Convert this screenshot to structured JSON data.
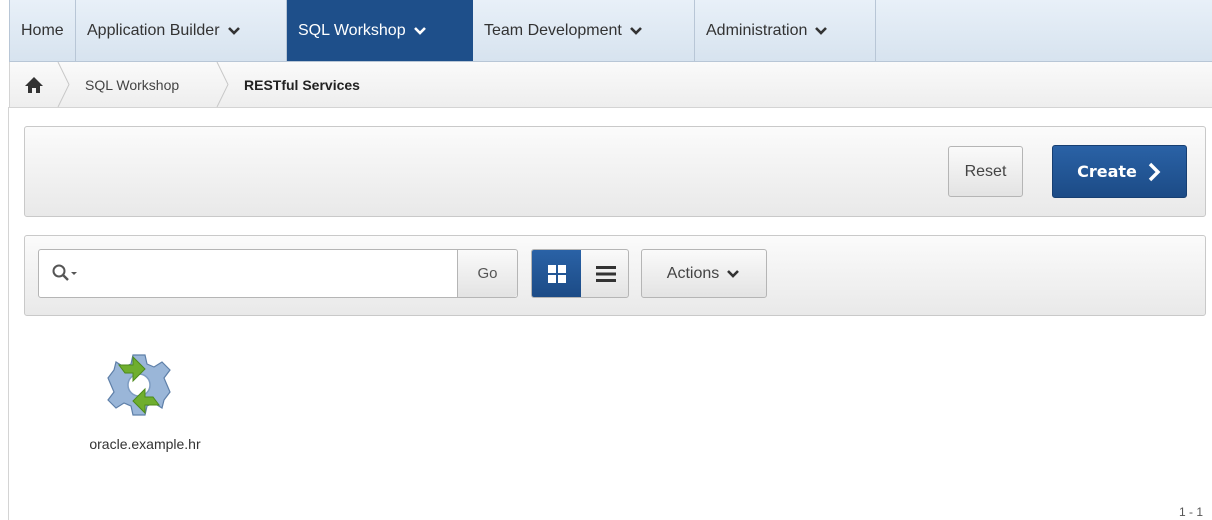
{
  "nav": {
    "tabs": [
      {
        "label": "Home",
        "has_menu": false
      },
      {
        "label": "Application Builder",
        "has_menu": true
      },
      {
        "label": "SQL Workshop",
        "has_menu": true,
        "active": true
      },
      {
        "label": "Team Development",
        "has_menu": true
      },
      {
        "label": "Administration",
        "has_menu": true
      }
    ]
  },
  "breadcrumb": {
    "home_icon": "home-icon",
    "items": [
      "SQL Workshop",
      "RESTful Services"
    ]
  },
  "toolbar": {
    "reset_label": "Reset",
    "create_label": "Create"
  },
  "report": {
    "search_placeholder": "",
    "search_value": "",
    "go_label": "Go",
    "actions_label": "Actions",
    "view_mode": "icons"
  },
  "items": [
    {
      "label": "oracle.example.hr",
      "icon": "gear-icon"
    }
  ],
  "pagination": "1 - 1",
  "colors": {
    "accent": "#1e4f8a",
    "nav_bg": "#dde7f1",
    "gear_blue": "#9ab6d8",
    "gear_green": "#6fae2e"
  }
}
